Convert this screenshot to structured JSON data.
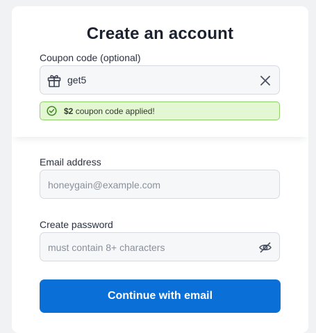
{
  "title": "Create an account",
  "coupon": {
    "label": "Coupon code (optional)",
    "value": "get5",
    "icon": "gift-icon",
    "clear_icon": "close-icon",
    "notice": {
      "amount": "$2",
      "text": " coupon code applied!",
      "icon": "check-circle-icon"
    }
  },
  "email": {
    "label": "Email address",
    "placeholder": "honeygain@example.com"
  },
  "password": {
    "label": "Create password",
    "placeholder": "must contain 8+ characters",
    "toggle_icon": "eye-off-icon"
  },
  "continue_label": "Continue with email",
  "colors": {
    "primary": "#0a6fd6",
    "success_bg": "#e4f7d3",
    "success_border": "#8ed06a",
    "success_icon": "#3c8a1e"
  }
}
